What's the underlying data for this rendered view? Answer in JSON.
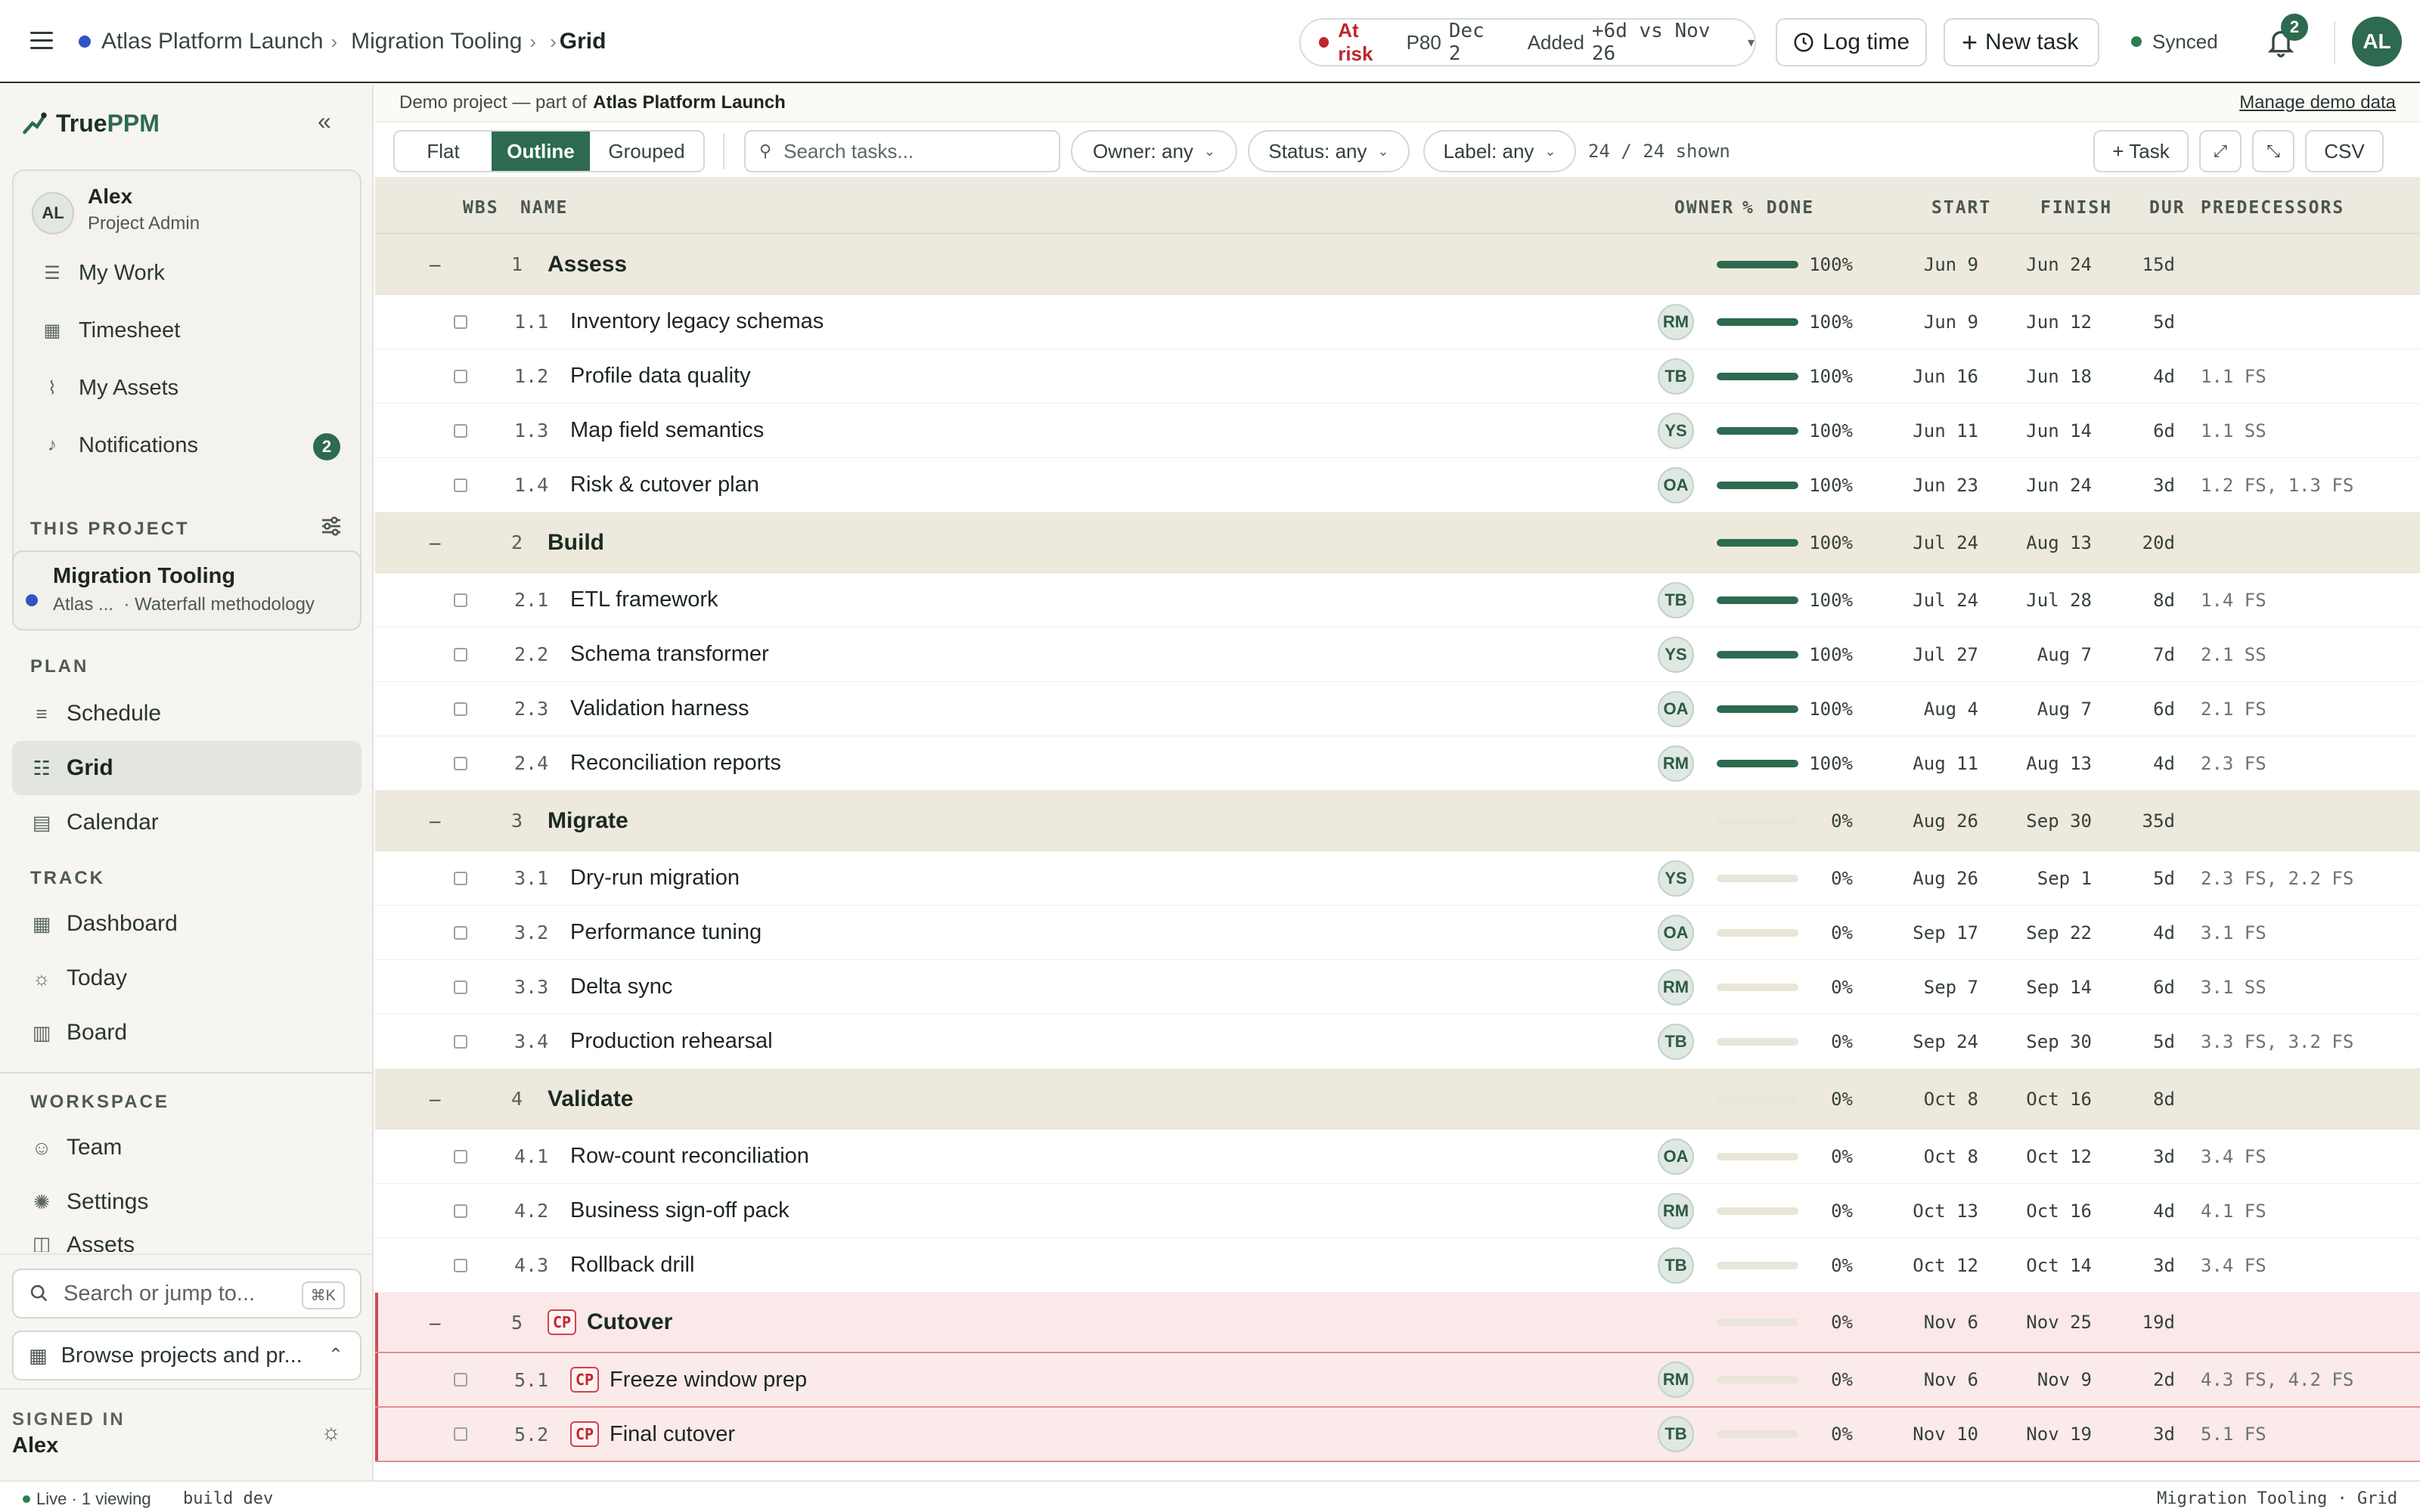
{
  "header": {
    "breadcrumbs": [
      "Atlas Platform Launch",
      "Migration Tooling",
      "Grid"
    ],
    "risk": {
      "status": "At risk",
      "p80_label": "P80",
      "p80_date": "Dec 2",
      "added_label": "Added",
      "added_value": "+6d vs Nov 26"
    },
    "log_time_label": "Log time",
    "new_task_label": "New task",
    "synced_label": "Synced",
    "notifications_count": "2",
    "avatar_initials": "AL",
    "colors": {
      "accent": "#2d6a4f",
      "risk": "#c0262d",
      "project_dot": "#2f55c4"
    }
  },
  "sidebar": {
    "brand_prefix": "True",
    "brand_suffix": "PPM",
    "user": {
      "initials": "AL",
      "name": "Alex",
      "role": "Project Admin"
    },
    "personal": [
      {
        "label": "My Work",
        "icon": "list-icon"
      },
      {
        "label": "Timesheet",
        "icon": "table-icon"
      },
      {
        "label": "My Assets",
        "icon": "paperclip-icon"
      },
      {
        "label": "Notifications",
        "icon": "bell-icon",
        "badge": "2"
      }
    ],
    "this_project_label": "THIS PROJECT",
    "project": {
      "name": "Migration Tooling",
      "program": "Atlas ...",
      "methodology": "· Waterfall methodology"
    },
    "plan_label": "PLAN",
    "plan": [
      {
        "label": "Schedule",
        "icon": "schedule-icon"
      },
      {
        "label": "Grid",
        "icon": "grid-list-icon",
        "active": true
      },
      {
        "label": "Calendar",
        "icon": "calendar-icon"
      }
    ],
    "track_label": "TRACK",
    "track": [
      {
        "label": "Dashboard",
        "icon": "dashboard-icon"
      },
      {
        "label": "Today",
        "icon": "sun-icon"
      },
      {
        "label": "Board",
        "icon": "board-icon"
      }
    ],
    "workspace_label": "WORKSPACE",
    "workspace": [
      {
        "label": "Team",
        "icon": "team-icon"
      },
      {
        "label": "Settings",
        "icon": "settings-icon"
      },
      {
        "label": "Assets",
        "icon": "assets-icon"
      }
    ],
    "search_placeholder": "Search or jump to...",
    "search_shortcut": "⌘K",
    "browse_label": "Browse projects and pr...",
    "signed_in_label": "SIGNED IN",
    "signed_in_name": "Alex"
  },
  "demo": {
    "prefix": "Demo project — part of",
    "program": "Atlas Platform Launch",
    "manage_label": "Manage demo data"
  },
  "toolbar": {
    "views": [
      "Flat",
      "Outline",
      "Grouped"
    ],
    "active_view": "Outline",
    "search_placeholder": "Search tasks...",
    "filters": [
      "Owner: any",
      "Status: any",
      "Label: any"
    ],
    "shown": "24 / 24 shown",
    "add_task_label": "+ Task",
    "expand_label": "⤢",
    "collapse_label": "⤡",
    "csv_label": "CSV"
  },
  "grid": {
    "columns": {
      "wbs": "WBS",
      "name": "NAME",
      "owner": "OWNER",
      "done": "% DONE",
      "start": "START",
      "finish": "FINISH",
      "dur": "DUR",
      "pred": "PREDECESSORS"
    },
    "rows": [
      {
        "type": "phase",
        "wbs": "1",
        "name": "Assess",
        "owner": "",
        "done": 100,
        "done_label": "100%",
        "start": "Jun 9",
        "finish": "Jun 24",
        "dur": "15d",
        "pred": "",
        "crit": false
      },
      {
        "type": "task",
        "wbs": "1.1",
        "name": "Inventory legacy schemas",
        "owner": "RM",
        "done": 100,
        "done_label": "100%",
        "start": "Jun 9",
        "finish": "Jun 12",
        "dur": "5d",
        "pred": "",
        "crit": false
      },
      {
        "type": "task",
        "wbs": "1.2",
        "name": "Profile data quality",
        "owner": "TB",
        "done": 100,
        "done_label": "100%",
        "start": "Jun 16",
        "finish": "Jun 18",
        "dur": "4d",
        "pred": "1.1 FS",
        "crit": false
      },
      {
        "type": "task",
        "wbs": "1.3",
        "name": "Map field semantics",
        "owner": "YS",
        "done": 100,
        "done_label": "100%",
        "start": "Jun 11",
        "finish": "Jun 14",
        "dur": "6d",
        "pred": "1.1 SS",
        "crit": false
      },
      {
        "type": "task",
        "wbs": "1.4",
        "name": "Risk & cutover plan",
        "owner": "OA",
        "done": 100,
        "done_label": "100%",
        "start": "Jun 23",
        "finish": "Jun 24",
        "dur": "3d",
        "pred": "1.2 FS, 1.3 FS",
        "crit": false
      },
      {
        "type": "phase",
        "wbs": "2",
        "name": "Build",
        "owner": "",
        "done": 100,
        "done_label": "100%",
        "start": "Jul 24",
        "finish": "Aug 13",
        "dur": "20d",
        "pred": "",
        "crit": false
      },
      {
        "type": "task",
        "wbs": "2.1",
        "name": "ETL framework",
        "owner": "TB",
        "done": 100,
        "done_label": "100%",
        "start": "Jul 24",
        "finish": "Jul 28",
        "dur": "8d",
        "pred": "1.4 FS",
        "crit": false
      },
      {
        "type": "task",
        "wbs": "2.2",
        "name": "Schema transformer",
        "owner": "YS",
        "done": 100,
        "done_label": "100%",
        "start": "Jul 27",
        "finish": "Aug 7",
        "dur": "7d",
        "pred": "2.1 SS",
        "crit": false
      },
      {
        "type": "task",
        "wbs": "2.3",
        "name": "Validation harness",
        "owner": "OA",
        "done": 100,
        "done_label": "100%",
        "start": "Aug 4",
        "finish": "Aug 7",
        "dur": "6d",
        "pred": "2.1 FS",
        "crit": false
      },
      {
        "type": "task",
        "wbs": "2.4",
        "name": "Reconciliation reports",
        "owner": "RM",
        "done": 100,
        "done_label": "100%",
        "start": "Aug 11",
        "finish": "Aug 13",
        "dur": "4d",
        "pred": "2.3 FS",
        "crit": false
      },
      {
        "type": "phase",
        "wbs": "3",
        "name": "Migrate",
        "owner": "",
        "done": 0,
        "done_label": "0%",
        "start": "Aug 26",
        "finish": "Sep 30",
        "dur": "35d",
        "pred": "",
        "crit": false
      },
      {
        "type": "task",
        "wbs": "3.1",
        "name": "Dry-run migration",
        "owner": "YS",
        "done": 0,
        "done_label": "0%",
        "start": "Aug 26",
        "finish": "Sep 1",
        "dur": "5d",
        "pred": "2.3 FS, 2.2 FS",
        "crit": false
      },
      {
        "type": "task",
        "wbs": "3.2",
        "name": "Performance tuning",
        "owner": "OA",
        "done": 0,
        "done_label": "0%",
        "start": "Sep 17",
        "finish": "Sep 22",
        "dur": "4d",
        "pred": "3.1 FS",
        "crit": false
      },
      {
        "type": "task",
        "wbs": "3.3",
        "name": "Delta sync",
        "owner": "RM",
        "done": 0,
        "done_label": "0%",
        "start": "Sep 7",
        "finish": "Sep 14",
        "dur": "6d",
        "pred": "3.1 SS",
        "crit": false
      },
      {
        "type": "task",
        "wbs": "3.4",
        "name": "Production rehearsal",
        "owner": "TB",
        "done": 0,
        "done_label": "0%",
        "start": "Sep 24",
        "finish": "Sep 30",
        "dur": "5d",
        "pred": "3.3 FS, 3.2 FS",
        "crit": false
      },
      {
        "type": "phase",
        "wbs": "4",
        "name": "Validate",
        "owner": "",
        "done": 0,
        "done_label": "0%",
        "start": "Oct 8",
        "finish": "Oct 16",
        "dur": "8d",
        "pred": "",
        "crit": false
      },
      {
        "type": "task",
        "wbs": "4.1",
        "name": "Row-count reconciliation",
        "owner": "OA",
        "done": 0,
        "done_label": "0%",
        "start": "Oct 8",
        "finish": "Oct 12",
        "dur": "3d",
        "pred": "3.4 FS",
        "crit": false
      },
      {
        "type": "task",
        "wbs": "4.2",
        "name": "Business sign-off pack",
        "owner": "RM",
        "done": 0,
        "done_label": "0%",
        "start": "Oct 13",
        "finish": "Oct 16",
        "dur": "4d",
        "pred": "4.1 FS",
        "crit": false
      },
      {
        "type": "task",
        "wbs": "4.3",
        "name": "Rollback drill",
        "owner": "TB",
        "done": 0,
        "done_label": "0%",
        "start": "Oct 12",
        "finish": "Oct 14",
        "dur": "3d",
        "pred": "3.4 FS",
        "crit": false
      },
      {
        "type": "phase",
        "wbs": "5",
        "name": "Cutover",
        "owner": "",
        "done": 0,
        "done_label": "0%",
        "start": "Nov 6",
        "finish": "Nov 25",
        "dur": "19d",
        "pred": "",
        "crit": true
      },
      {
        "type": "task",
        "wbs": "5.1",
        "name": "Freeze window prep",
        "owner": "RM",
        "done": 0,
        "done_label": "0%",
        "start": "Nov 6",
        "finish": "Nov 9",
        "dur": "2d",
        "pred": "4.3 FS, 4.2 FS",
        "crit": true
      },
      {
        "type": "task",
        "wbs": "5.2",
        "name": "Final cutover",
        "owner": "TB",
        "done": 0,
        "done_label": "0%",
        "start": "Nov 10",
        "finish": "Nov 19",
        "dur": "3d",
        "pred": "5.1 FS",
        "crit": true
      }
    ],
    "cp_label": "CP",
    "collapse_glyph": "–"
  },
  "statusbar": {
    "live": "Live · 1 viewing",
    "build": "build dev",
    "context": "Migration Tooling · Grid"
  }
}
